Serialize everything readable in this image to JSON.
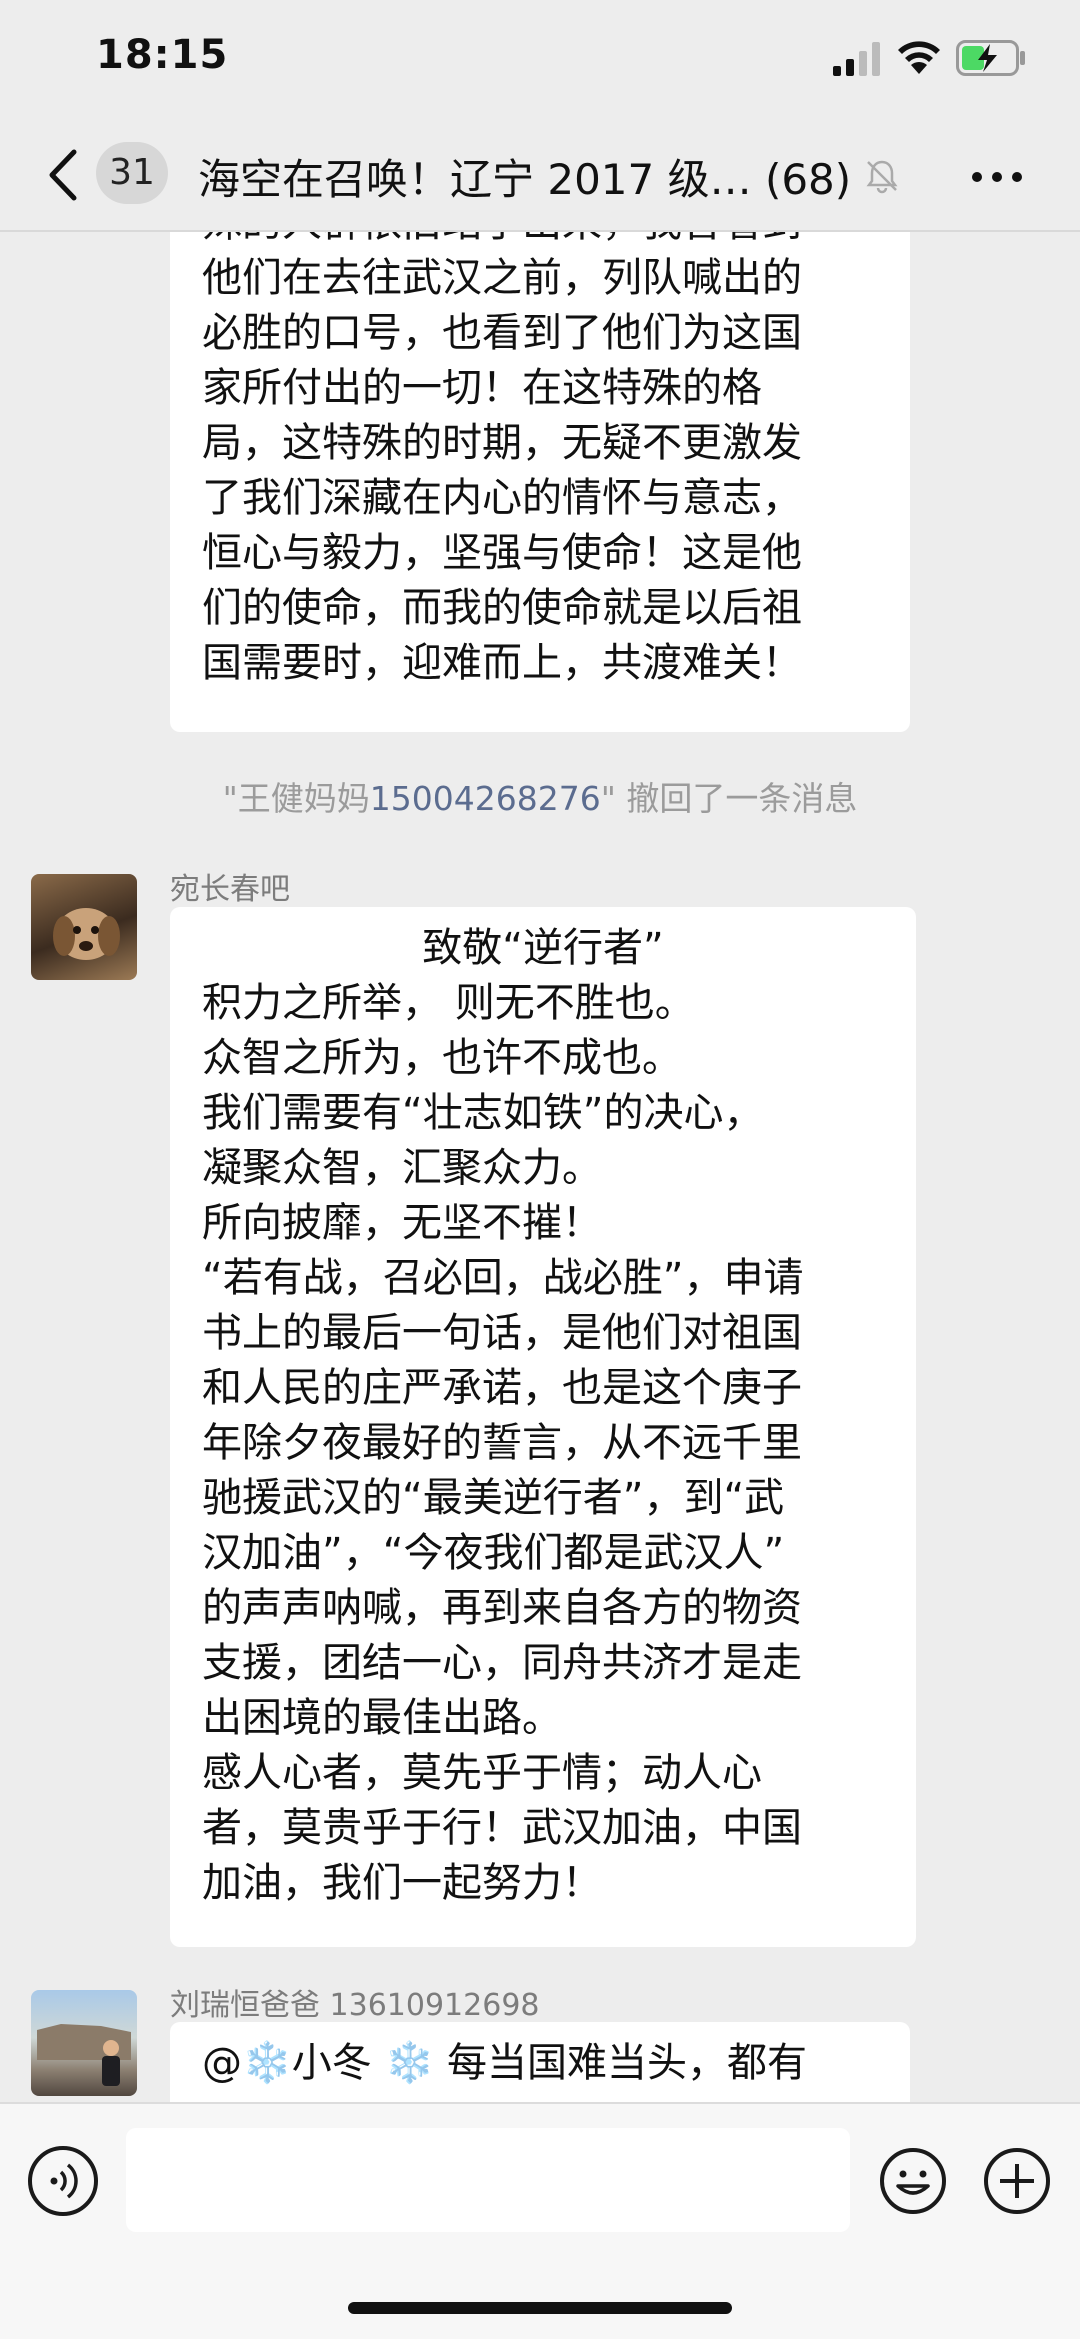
{
  "status_bar": {
    "time": "18:15"
  },
  "header": {
    "back_icon": "chevron-left-icon",
    "unread_count": "31",
    "title": "海空在召唤！辽宁 2017 级… (68)",
    "mute_icon": "bell-off-icon",
    "more_icon": "more-dots-icon"
  },
  "messages": {
    "m1": {
      "lines": [
        "殊的人群依旧站了出来，我曾看到",
        "他们在去往武汉之前，列队喊出的",
        "必胜的口号，也看到了他们为这国",
        "家所付出的一切！在这特殊的格",
        "局，这特殊的时期，无疑不更激发",
        "了我们深藏在内心的情怀与意志，",
        "恒心与毅力，坚强与使命！这是他",
        "们的使命，而我的使命就是以后祖",
        "国需要时，迎难而上，共渡难关！"
      ]
    },
    "recall": {
      "prefix": "\"王健妈妈",
      "number": "15004268276",
      "suffix": "\" 撤回了一条消息"
    },
    "m2": {
      "sender": "宛长春吧",
      "lines": [
        "致敬“逆行者”",
        "积力之所举， 则无不胜也。",
        "众智之所为，也许不成也。",
        "我们需要有“壮志如铁”的决心，",
        "凝聚众智，汇聚众力。",
        "所向披靡，无坚不摧！",
        "“若有战，召必回，战必胜”，申请",
        "书上的最后一句话，是他们对祖国",
        "和人民的庄严承诺，也是这个庚子",
        "年除夕夜最好的誓言，从不远千里",
        "驰援武汉的“最美逆行者”，到“武",
        "汉加油”，“今夜我们都是武汉人”",
        "的声声呐喊，再到来自各方的物资",
        "支援，团结一心，同舟共济才是走",
        "出困境的最佳出路。",
        "感人心者，莫先乎于情；动人心",
        "者，莫贵乎于行！武汉加油，中国",
        "加油，我们一起努力！"
      ]
    },
    "m3": {
      "sender": "刘瑞恒爸爸   13610912698",
      "lines": [
        "@❄️小冬 ❄️ 每当国难当头，都有"
      ]
    }
  },
  "input_bar": {
    "voice_icon": "voice-icon",
    "emoji_icon": "emoji-icon",
    "plus_icon": "plus-icon"
  }
}
